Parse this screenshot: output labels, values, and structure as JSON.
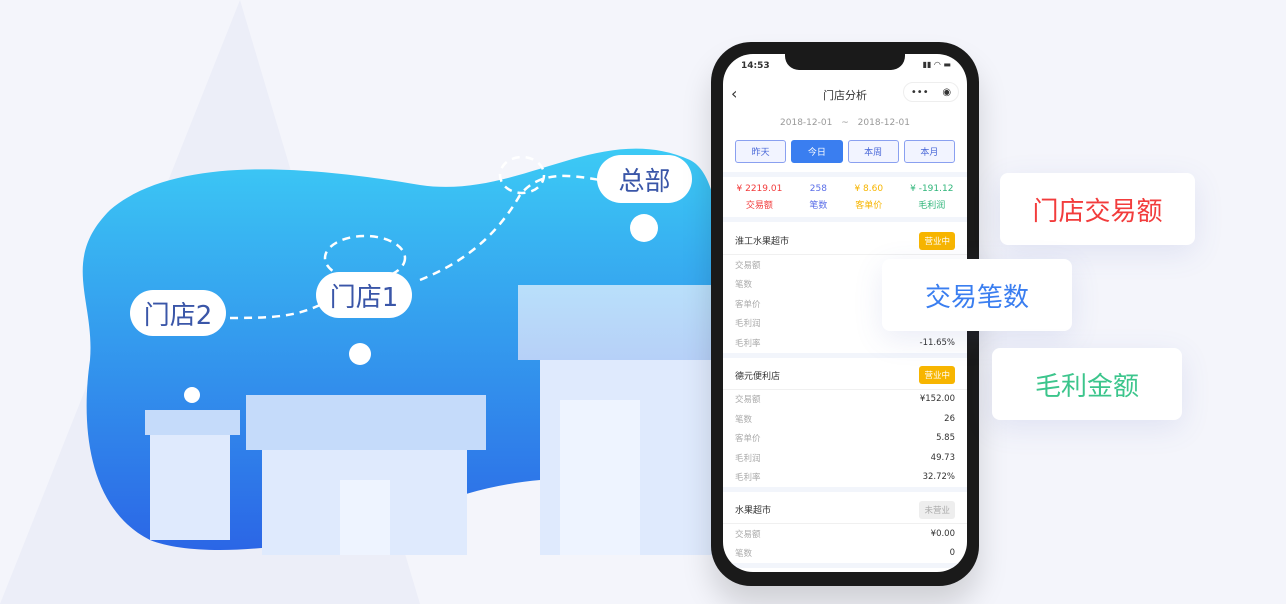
{
  "illustration": {
    "hq_label": "总部",
    "store1_label": "门店1",
    "store2_label": "门店2"
  },
  "feature_cards": [
    {
      "label": "门店交易额",
      "color": "#f23c3c"
    },
    {
      "label": "交易笔数",
      "color": "#3a7ef0"
    },
    {
      "label": "毛利金额",
      "color": "#3cc58c"
    }
  ],
  "phone": {
    "status_time": "14:53",
    "title": "门店分析",
    "date_range": {
      "start": "2018-12-01",
      "sep": "~",
      "end": "2018-12-01"
    },
    "tabs": [
      {
        "label": "昨天"
      },
      {
        "label": "今日",
        "active": true
      },
      {
        "label": "本周"
      },
      {
        "label": "本月"
      }
    ],
    "summary": [
      {
        "value": "¥ 2219.01",
        "label": "交易额",
        "color": "#f23c3c"
      },
      {
        "value": "258",
        "label": "笔数",
        "color": "#5a6ee8"
      },
      {
        "value": "¥ 8.60",
        "label": "客单价",
        "color": "#f7b500"
      },
      {
        "value": "¥ -191.12",
        "label": "毛利润",
        "color": "#2fb57a"
      }
    ],
    "stores": [
      {
        "name": "淮工水果超市",
        "status": "营业中",
        "rows": [
          {
            "k": "交易额",
            "v": ""
          },
          {
            "k": "笔数",
            "v": ""
          },
          {
            "k": "客单价",
            "v": ""
          },
          {
            "k": "毛利润",
            "v": ""
          },
          {
            "k": "毛利率",
            "v": "-11.65%"
          }
        ]
      },
      {
        "name": "德元便利店",
        "status": "营业中",
        "rows": [
          {
            "k": "交易额",
            "v": "¥152.00"
          },
          {
            "k": "笔数",
            "v": "26"
          },
          {
            "k": "客单价",
            "v": "5.85"
          },
          {
            "k": "毛利润",
            "v": "49.73"
          },
          {
            "k": "毛利率",
            "v": "32.72%"
          }
        ]
      },
      {
        "name": "水果超市",
        "status": "未营业",
        "rows": [
          {
            "k": "交易额",
            "v": "¥0.00"
          },
          {
            "k": "笔数",
            "v": "0"
          }
        ]
      }
    ]
  }
}
